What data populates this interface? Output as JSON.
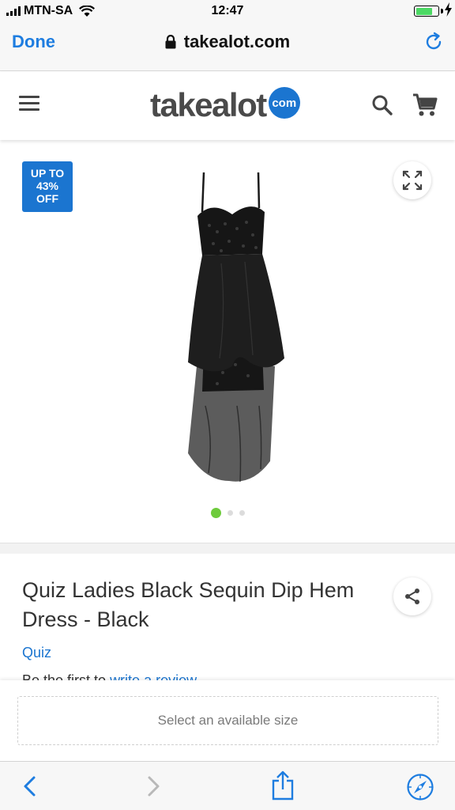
{
  "status_bar": {
    "carrier": "MTN-SA",
    "time": "12:47",
    "battery_level": 0.68
  },
  "browser": {
    "done_label": "Done",
    "url": "takealot.com"
  },
  "site": {
    "logo_text": "takealot",
    "logo_badge": "com",
    "brand_color": "#1b75d0"
  },
  "gallery": {
    "promo_badge": [
      "UP TO",
      "43%",
      "OFF"
    ],
    "image_count": 3,
    "active_index": 0,
    "active_dot_color": "#6ecb3c"
  },
  "product": {
    "title": "Quiz Ladies Black Sequin Dip Hem Dress - Black",
    "brand": "Quiz",
    "review_prefix": "Be the first to ",
    "review_link": "write a review"
  },
  "size_selector": {
    "placeholder": "Select an available size"
  },
  "icons": {
    "menu": "hamburger-icon",
    "search": "search-icon",
    "cart": "cart-icon",
    "expand": "expand-icon",
    "share": "share-icon",
    "back": "back-icon",
    "forward": "forward-icon",
    "upload": "share-upload-icon",
    "compass": "compass-icon",
    "reload": "reload-icon",
    "lock": "lock-icon"
  }
}
